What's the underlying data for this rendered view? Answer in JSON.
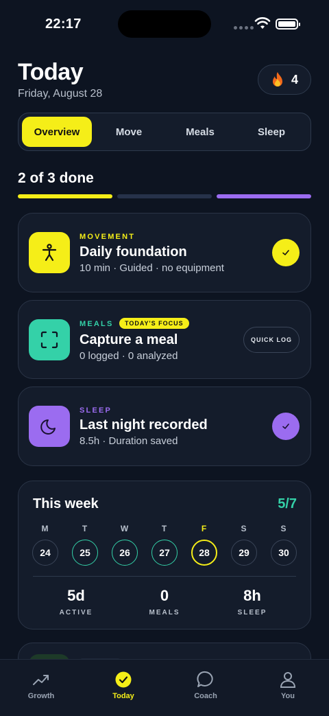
{
  "status_bar": {
    "time": "22:17"
  },
  "header": {
    "title": "Today",
    "date": "Friday, August 28",
    "streak_icon": "fire-icon",
    "streak_count": "4"
  },
  "tabs": [
    {
      "label": "Overview",
      "active": true
    },
    {
      "label": "Move",
      "active": false
    },
    {
      "label": "Meals",
      "active": false
    },
    {
      "label": "Sleep",
      "active": false
    }
  ],
  "progress": {
    "label": "2 of 3 done",
    "segments": [
      {
        "color": "#f5ee18",
        "done": true
      },
      {
        "color": "#26324a",
        "done": false
      },
      {
        "color": "#9b6cf0",
        "done": true
      }
    ]
  },
  "cards": {
    "movement": {
      "category": "MOVEMENT",
      "title": "Daily foundation",
      "meta": "10 min · Guided · no equipment",
      "icon": "person-icon",
      "accent": "#f5ee18",
      "completed": true
    },
    "meals": {
      "category": "MEALS",
      "badge": "TODAY'S FOCUS",
      "title": "Capture a meal",
      "meta": "0 logged · 0 analyzed",
      "icon": "scan-icon",
      "accent": "#34d1a8",
      "action": "QUICK LOG"
    },
    "sleep": {
      "category": "SLEEP",
      "title": "Last night recorded",
      "meta": "8.5h · Duration saved",
      "icon": "moon-icon",
      "accent": "#9b6cf0",
      "completed": true
    }
  },
  "week": {
    "title": "This week",
    "count": "5/7",
    "days": [
      {
        "letter": "M",
        "date": "24",
        "state": "none"
      },
      {
        "letter": "T",
        "date": "25",
        "state": "done"
      },
      {
        "letter": "W",
        "date": "26",
        "state": "done"
      },
      {
        "letter": "T",
        "date": "27",
        "state": "done"
      },
      {
        "letter": "F",
        "date": "28",
        "state": "today"
      },
      {
        "letter": "S",
        "date": "29",
        "state": "none"
      },
      {
        "letter": "S",
        "date": "30",
        "state": "none"
      }
    ],
    "stats": [
      {
        "value": "5d",
        "label": "ACTIVE"
      },
      {
        "value": "0",
        "label": "MEALS"
      },
      {
        "value": "8h",
        "label": "SLEEP"
      }
    ]
  },
  "bottom_nav": [
    {
      "label": "Growth",
      "icon": "trend-icon",
      "active": false
    },
    {
      "label": "Today",
      "icon": "check-circle-icon",
      "active": true
    },
    {
      "label": "Coach",
      "icon": "chat-icon",
      "active": false
    },
    {
      "label": "You",
      "icon": "person-outline-icon",
      "active": false
    }
  ],
  "colors": {
    "background": "#0d1421",
    "card": "#141c2b",
    "yellow": "#f5ee18",
    "teal": "#34d1a8",
    "purple": "#9b6cf0"
  }
}
